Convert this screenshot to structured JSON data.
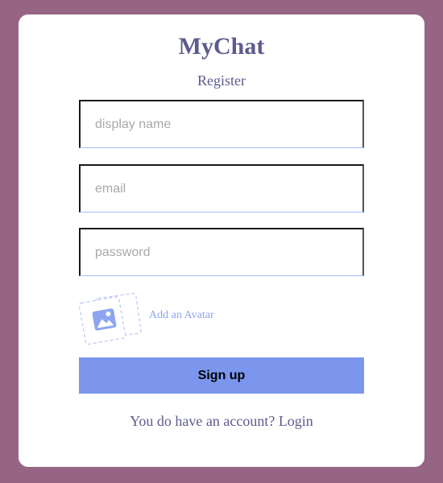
{
  "app": {
    "logo": "MyChat",
    "subtitle": "Register"
  },
  "form": {
    "display_name": {
      "placeholder": "display name",
      "value": ""
    },
    "email": {
      "placeholder": "email",
      "value": ""
    },
    "password": {
      "placeholder": "password",
      "value": ""
    },
    "avatar": {
      "label": "Add an Avatar",
      "icon": "image-icon"
    },
    "submit_label": "Sign up"
  },
  "footer": {
    "prompt": "You do have an account?",
    "link_label": "Login"
  },
  "colors": {
    "background": "#966584",
    "card": "#ffffff",
    "brand_text": "#5d5b8d",
    "accent": "#7b96ec",
    "avatar_label": "#8da4f1"
  }
}
